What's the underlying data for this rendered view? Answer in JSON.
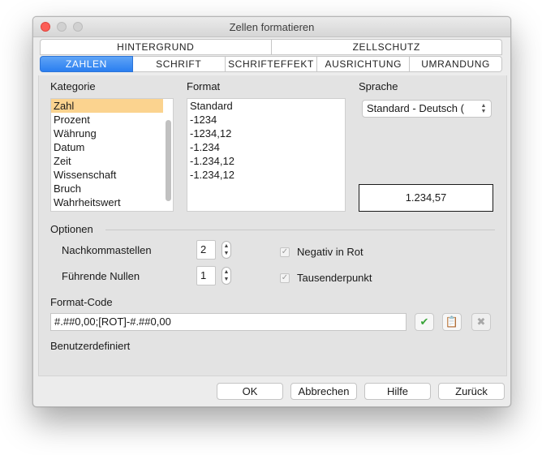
{
  "window": {
    "title": "Zellen formatieren"
  },
  "tabs_row1": [
    {
      "label": "Hintergrund"
    },
    {
      "label": "Zellschutz"
    }
  ],
  "tabs_row2": [
    {
      "label": "Zahlen",
      "active": true
    },
    {
      "label": "Schrift"
    },
    {
      "label": "Schrifteffekt"
    },
    {
      "label": "Ausrichtung"
    },
    {
      "label": "Umrandung"
    }
  ],
  "category": {
    "label": "Kategorie",
    "selected": "Zahl",
    "items": [
      "Zahl",
      "Prozent",
      "Währung",
      "Datum",
      "Zeit",
      "Wissenschaft",
      "Bruch",
      "Wahrheitswert"
    ]
  },
  "format": {
    "label": "Format",
    "items": [
      "Standard",
      "-1234",
      "-1234,12",
      "-1.234",
      "-1.234,12",
      "-1.234,12"
    ]
  },
  "language": {
    "label": "Sprache",
    "value": "Standard - Deutsch ("
  },
  "preview": {
    "value": "1.234,57"
  },
  "options": {
    "label": "Optionen",
    "decimal_places_label": "Nachkommastellen",
    "decimal_places_value": "2",
    "leading_zeros_label": "Führende Nullen",
    "leading_zeros_value": "1",
    "negative_red_label": "Negativ in Rot",
    "negative_red_checked": true,
    "thousands_sep_label": "Tausenderpunkt",
    "thousands_sep_checked": true
  },
  "format_code": {
    "label": "Format-Code",
    "value": "#.##0,00;[ROT]-#.##0,00",
    "description": "Benutzerdefiniert"
  },
  "buttons": {
    "ok": "OK",
    "cancel": "Abbrechen",
    "help": "Hilfe",
    "back": "Zurück"
  },
  "colors": {
    "accent": "#2a7ef0",
    "selection": "#fbd38f",
    "close": "#fc5f57",
    "check_green": "#3aa53a"
  }
}
